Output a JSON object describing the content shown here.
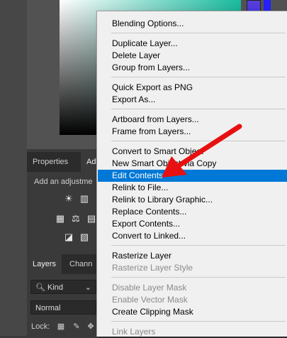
{
  "properties_panel": {
    "tabs": [
      "Properties",
      "Ad"
    ],
    "adjustments_text": "Add an adjustme"
  },
  "layers_panel": {
    "tabs": [
      "Layers",
      "Chann"
    ],
    "kind_filter": "Kind",
    "blend_mode": "Normal",
    "lock_label": "Lock:"
  },
  "context_menu": {
    "groups": [
      [
        {
          "label": "Blending Options...",
          "enabled": true
        }
      ],
      [
        {
          "label": "Duplicate Layer...",
          "enabled": true
        },
        {
          "label": "Delete Layer",
          "enabled": true
        },
        {
          "label": "Group from Layers...",
          "enabled": true
        }
      ],
      [
        {
          "label": "Quick Export as PNG",
          "enabled": true
        },
        {
          "label": "Export As...",
          "enabled": true
        }
      ],
      [
        {
          "label": "Artboard from Layers...",
          "enabled": true
        },
        {
          "label": "Frame from Layers...",
          "enabled": true
        }
      ],
      [
        {
          "label": "Convert to Smart Object",
          "enabled": true
        },
        {
          "label": "New Smart Object via Copy",
          "enabled": true
        },
        {
          "label": "Edit Contents",
          "enabled": true,
          "highlighted": true
        },
        {
          "label": "Relink to File...",
          "enabled": true
        },
        {
          "label": "Relink to Library Graphic...",
          "enabled": true
        },
        {
          "label": "Replace Contents...",
          "enabled": true
        },
        {
          "label": "Export Contents...",
          "enabled": true
        },
        {
          "label": "Convert to Linked...",
          "enabled": true
        }
      ],
      [
        {
          "label": "Rasterize Layer",
          "enabled": true
        },
        {
          "label": "Rasterize Layer Style",
          "enabled": false
        }
      ],
      [
        {
          "label": "Disable Layer Mask",
          "enabled": false
        },
        {
          "label": "Enable Vector Mask",
          "enabled": false
        },
        {
          "label": "Create Clipping Mask",
          "enabled": true
        }
      ],
      [
        {
          "label": "Link Layers",
          "enabled": false
        }
      ]
    ]
  },
  "colors": {
    "highlight": "#0078d7",
    "arrow": "#e81010",
    "menu_bg": "#f0f0f0"
  }
}
